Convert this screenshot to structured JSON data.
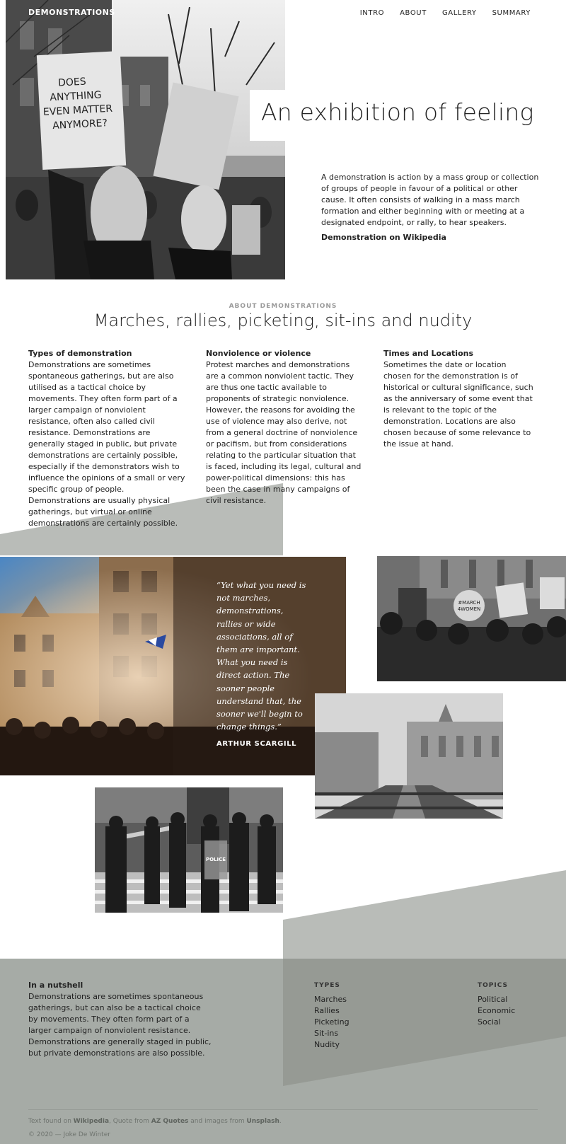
{
  "nav": {
    "brand": "DEMONSTRATIONS",
    "items": [
      "INTRO",
      "ABOUT",
      "GALLERY",
      "SUMMARY"
    ]
  },
  "hero": {
    "title": "An exhibition of feeling",
    "description": "A demonstration is action by a mass group or collection of groups of people in favour of a political or other cause. It often consists of walking in a mass march formation and either beginning with or meeting at a designated endpoint, or rally, to hear speakers.",
    "link": "Demonstration on Wikipedia",
    "sign_text": "DOES ANYTHING EVEN MATTER ANYMORE?"
  },
  "about": {
    "eyebrow": "ABOUT DEMONSTRATIONS",
    "title": "Marches, rallies, picketing, sit-ins and nudity",
    "columns": [
      {
        "heading": "Types of demonstration",
        "text": "Demonstrations are sometimes spontaneous gatherings, but are also utilised as a tactical choice by movements. They often form part of a larger campaign of nonviolent resistance, often also called civil resistance. Demonstrations are generally staged in public, but private demonstrations are certainly possible, especially if the demonstrators wish to influence the opinions of a small or very specific group of people. Demonstrations are usually physical gatherings, but virtual or online demonstrations are certainly possible."
      },
      {
        "heading": "Nonviolence or violence",
        "text": "Protest marches and demonstrations are a common nonviolent tactic. They are thus one tactic available to proponents of strategic nonviolence. However, the reasons for avoiding the use of violence may also derive, not from a general doctrine of nonviolence or pacifism, but from considerations relating to the particular situation that is faced, including its legal, cultural and power-political dimensions: this has been the case in many campaigns of civil resistance."
      },
      {
        "heading": "Times and Locations",
        "text": "Sometimes the date or location chosen for the demonstration is of historical or cultural significance, such as the anniversary of some event that is relevant to the topic of the demonstration. Locations are also chosen because of some relevance to the issue at hand."
      }
    ]
  },
  "gallery": {
    "quote": "“Yet what you need is not marches, demonstrations, rallies or wide associations, all of them are important. What you need is direct action. The sooner people understand that, the sooner we'll begin to change things.”",
    "author": "ARTHUR SCARGILL",
    "sign_march": "#MARCH 4WOMEN",
    "sign_police": "POLICE"
  },
  "footer": {
    "nutshell_heading": "In a nutshell",
    "nutshell_text": "Demonstrations are sometimes spontaneous gatherings, but can also be a tactical choice by movements. They often form part of a larger campaign of nonviolent resistance. Demonstrations are generally staged in public, but private demonstrations are also possible.",
    "types_heading": "TYPES",
    "types": [
      "Marches",
      "Rallies",
      "Picketing",
      "Sit-ins",
      "Nudity"
    ],
    "topics_heading": "TOPICS",
    "topics": [
      "Political",
      "Economic",
      "Social"
    ],
    "credits": {
      "prefix": "Text found on ",
      "source1": "Wikipedia",
      "mid1": ", Quote from ",
      "source2": "AZ Quotes",
      "mid2": " and images from ",
      "source3": "Unsplash",
      "suffix": "."
    },
    "copyright": "© 2020 — Joke De Winter"
  },
  "colors": {
    "grey_shape": "#b9bcb8",
    "footer_bg": "#a6aba6",
    "footer_shape": "#969a94",
    "text": "#1a1a1a"
  }
}
